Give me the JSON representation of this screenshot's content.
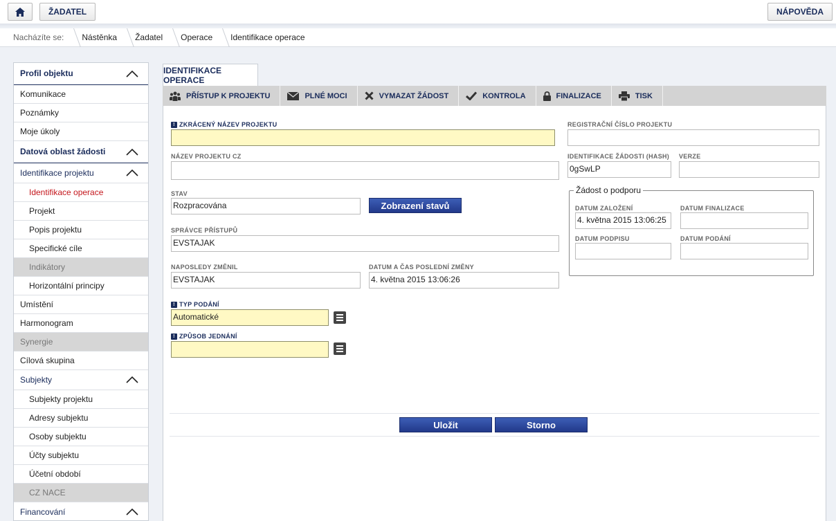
{
  "topbar": {
    "home_icon": "home-icon",
    "zadatel_label": "ŽADATEL",
    "napoveda_label": "NÁPOVĚDA"
  },
  "breadcrumb": {
    "lead": "Nacházíte se:",
    "items": [
      "Nástěnka",
      "Žadatel",
      "Operace",
      "Identifikace operace"
    ]
  },
  "sidebar": {
    "items": [
      {
        "label": "Profil objektu"
      },
      {
        "label": "Komunikace"
      },
      {
        "label": "Poznámky"
      },
      {
        "label": "Moje úkoly"
      },
      {
        "label": "Datová oblast žádosti"
      },
      {
        "label": "Identifikace projektu"
      },
      {
        "label": "Identifikace operace"
      },
      {
        "label": "Projekt"
      },
      {
        "label": "Popis projektu"
      },
      {
        "label": "Specifické cíle"
      },
      {
        "label": "Indikátory"
      },
      {
        "label": "Horizontální principy"
      },
      {
        "label": "Umístění"
      },
      {
        "label": "Harmonogram"
      },
      {
        "label": "Synergie"
      },
      {
        "label": "Cílová skupina"
      },
      {
        "label": "Subjekty"
      },
      {
        "label": "Subjekty projektu"
      },
      {
        "label": "Adresy subjektu"
      },
      {
        "label": "Osoby subjektu"
      },
      {
        "label": "Účty subjektu"
      },
      {
        "label": "Účetní období"
      },
      {
        "label": "CZ NACE"
      },
      {
        "label": "Financování"
      }
    ]
  },
  "tab": {
    "title": "IDENTIFIKACE OPERACE"
  },
  "toolbar": {
    "pristup": "PŘÍSTUP K PROJEKTU",
    "plne_moci": "PLNÉ MOCI",
    "vymazat": "VYMAZAT ŽÁDOST",
    "kontrola": "KONTROLA",
    "finalizace": "FINALIZACE",
    "tisk": "TISK"
  },
  "form": {
    "zkraceny_nazev": {
      "label": "ZKRÁCENÝ NÁZEV PROJEKTU",
      "value": ""
    },
    "nazev_cz": {
      "label": "NÁZEV PROJEKTU CZ",
      "value": ""
    },
    "stav": {
      "label": "STAV",
      "value": "Rozpracována"
    },
    "zobrazeni_stavu": "Zobrazení stavů",
    "spravce": {
      "label": "SPRÁVCE PŘÍSTUPŮ",
      "value": "EVSTAJAK"
    },
    "naposledy": {
      "label": "NAPOSLEDY ZMĚNIL",
      "value": "EVSTAJAK"
    },
    "datum_zmeny": {
      "label": "DATUM A ČAS POSLEDNÍ ZMĚNY",
      "value": "4. května 2015 13:06:26"
    },
    "typ_podani": {
      "label": "TYP PODÁNÍ",
      "value": "Automatické"
    },
    "zpusob_jednani": {
      "label": "ZPŮSOB JEDNÁNÍ",
      "value": ""
    },
    "registracni": {
      "label": "REGISTRAČNÍ ČÍSLO PROJEKTU",
      "value": ""
    },
    "hash": {
      "label": "IDENTIFIKACE ŽÁDOSTI (HASH)",
      "value": "0gSwLP"
    },
    "verze": {
      "label": "VERZE",
      "value": ""
    },
    "zadost": {
      "legend": "Žádost o podporu",
      "datum_zalozeni": {
        "label": "DATUM ZALOŽENÍ",
        "value": "4. května 2015 13:06:25"
      },
      "datum_finalizace": {
        "label": "DATUM FINALIZACE",
        "value": ""
      },
      "datum_podpisu": {
        "label": "DATUM PODPISU",
        "value": ""
      },
      "datum_podani": {
        "label": "DATUM PODÁNÍ",
        "value": ""
      }
    }
  },
  "actions": {
    "ulozit": "Uložit",
    "storno": "Storno"
  },
  "colors": {
    "brand": "#1a2c5b",
    "active": "#c4161c",
    "required_bg": "#fff9c4"
  }
}
